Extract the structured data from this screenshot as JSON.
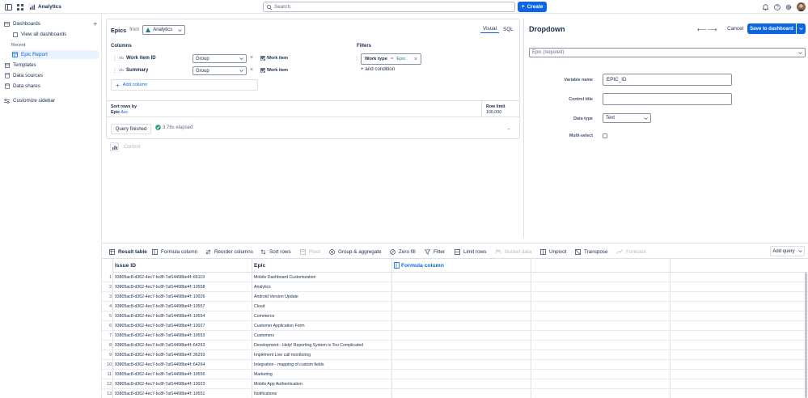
{
  "app": {
    "title": "Analytics"
  },
  "search": {
    "placeholder": "Search"
  },
  "create_label": "Create",
  "sidebar": {
    "dashboards": "Dashboards",
    "view_all": "View all dashboards",
    "recent": "Recent",
    "epic_report": "Epic Report",
    "templates": "Templates",
    "data_sources": "Data sources",
    "data_shares": "Data shares",
    "customize": "Customize sidebar"
  },
  "query": {
    "epics": "Epics",
    "from": "from",
    "source": "Analytics",
    "tab_visual": "Visual",
    "tab_sql": "SQL",
    "columns_label": "Columns",
    "filters_label": "Filters",
    "columns": [
      {
        "type": "Ab",
        "name": "Work item ID",
        "agg": "Group",
        "check_label": "Work item"
      },
      {
        "type": "Ab",
        "name": "Summary",
        "agg": "Group",
        "check_label": "Work item"
      }
    ],
    "add_column": "Add column",
    "filter": {
      "field": "Work type",
      "op": "=",
      "value": "Epic"
    },
    "and_condition": "+ and condition",
    "sort_label": "Sort rows by",
    "sort_field": "Epic",
    "sort_dir": "Asc",
    "row_limit_label": "Row limit",
    "row_limit": "100,000",
    "query_finished": "Query finished",
    "elapsed": "3.76s elapsed",
    "control": "Control"
  },
  "control": {
    "title": "Dropdown",
    "cancel": "Cancel",
    "save": "Save to dashboard",
    "epic_placeholder": "Epic (required)",
    "variable_name_label": "Variable name",
    "variable_name": "EPIC_ID",
    "control_title_label": "Control title",
    "control_title": "",
    "data_type_label": "Data type",
    "data_type": "Text",
    "multi_select_label": "Multi-select"
  },
  "toolbar": {
    "result_table": "Result table",
    "formula_column": "Formula column",
    "reorder_columns": "Reorder columns",
    "sort_rows": "Sort rows",
    "pivot": "Pivot",
    "group_aggregate": "Group & aggregate",
    "zero_fill": "Zero fill",
    "filter": "Filter",
    "limit_rows": "Limit rows",
    "bucket_data": "Bucket data",
    "unpivot": "Unpivot",
    "transpose": "Transpose",
    "forecast": "Forecast",
    "add_query": "Add query"
  },
  "table": {
    "headers": [
      "Issue ID",
      "Epic",
      "Formula column"
    ],
    "rows": [
      [
        "1",
        "93805ac8-d362-4ec7-bc8f-7af14498be4f::66119",
        "Mobile Dashboard Customization"
      ],
      [
        "2",
        "93805ac8-d362-4ec7-bc8f-7af14498be4f::10558",
        "Analytics"
      ],
      [
        "3",
        "93805ac8-d362-4ec7-bc8f-7af14498be4f::10026",
        "Android Version Update"
      ],
      [
        "4",
        "93805ac8-d362-4ec7-bc8f-7af14498be4f::10557",
        "Cloud"
      ],
      [
        "5",
        "93805ac8-d362-4ec7-bc8f-7af14498be4f::10554",
        "Commerce"
      ],
      [
        "6",
        "93805ac8-d362-4ec7-bc8f-7af14498be4f::10027",
        "Customer Application Form"
      ],
      [
        "7",
        "93805ac8-d362-4ec7-bc8f-7af14498be4f::10553",
        "Customers"
      ],
      [
        "8",
        "93805ac8-d362-4ec7-bc8f-7af14498be4f::64263",
        "Development - Help! Reporting System is Too Complicated"
      ],
      [
        "9",
        "93805ac8-d362-4ec7-bc8f-7af14498be4f::36293",
        "Implement Live call monitoring"
      ],
      [
        "10",
        "93805ac8-d362-4ec7-bc8f-7af14498be4f::64264",
        "Integration - mapping of custom fields"
      ],
      [
        "11",
        "93805ac8-d362-4ec7-bc8f-7af14498be4f::10556",
        "Marketing"
      ],
      [
        "12",
        "93805ac8-d362-4ec7-bc8f-7af14498be4f::10023",
        "Mobile App Authentication"
      ],
      [
        "13",
        "93805ac8-d362-4ec7-bc8f-7af14498be4f::10551",
        "Notifications"
      ]
    ]
  },
  "colors": {
    "accent": "#0c66e4",
    "teal": "#1d7f8c",
    "success": "#22a06b"
  }
}
